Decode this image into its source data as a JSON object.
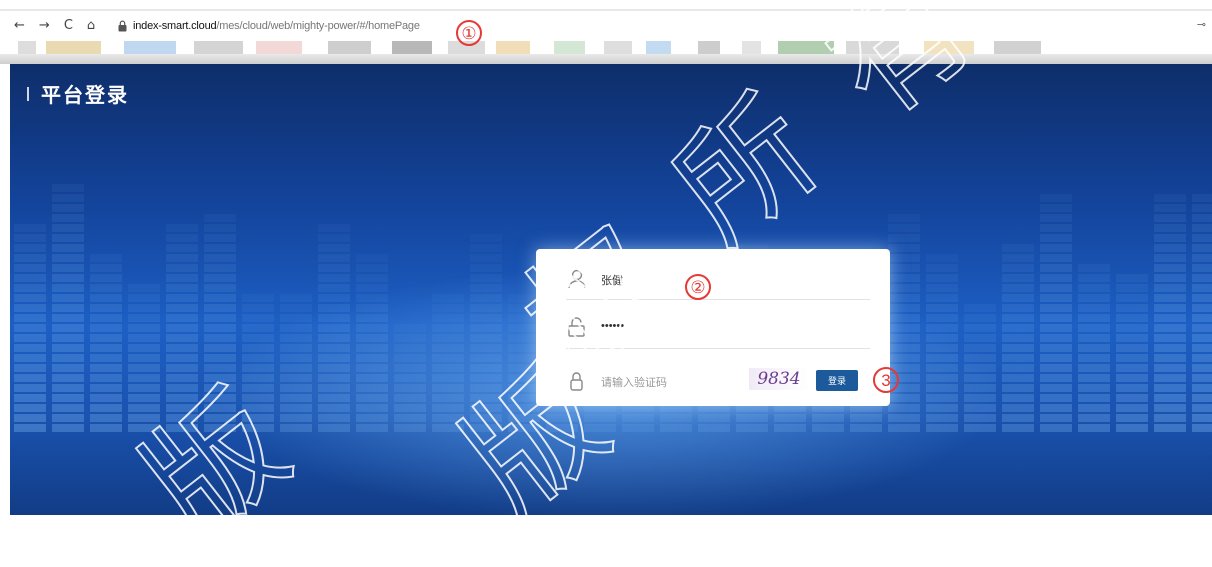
{
  "browser": {
    "nav": {
      "back": "←",
      "forward": "→",
      "reload": "C",
      "home": "⌂"
    },
    "url": {
      "host": "index-smart.cloud",
      "path": "/mes/cloud/web/mighty-power/#/homePage"
    },
    "bookmark_colors": [
      "#d9d9d9",
      "#e7d6a8",
      "#b9d3ee",
      "#cfcfcf",
      "#f2d4d4",
      "#c9c9c9",
      "#b0b0b0",
      "#d8d8d8",
      "#f0d9b0",
      "#cfe3cf",
      "#dadada",
      "#bcd7f0",
      "#c8c8c8",
      "#e0e0e0",
      "#a9c9a9",
      "#d5d5d5",
      "#f0e0b8",
      "#cccccc"
    ]
  },
  "callouts": [
    "①",
    "②",
    "3"
  ],
  "page": {
    "title": "平台登录"
  },
  "login": {
    "username": "张健",
    "password": "••••••",
    "captcha_placeholder": "请输入验证码",
    "captcha_code": "9834",
    "button": "登录"
  },
  "watermark": {
    "chars": [
      "版",
      "权",
      "所",
      "有",
      "版"
    ]
  },
  "colors": {
    "accent": "#1c5a9b",
    "callout": "#e53935",
    "bg_top": "#0e2e6a",
    "bg_mid": "#1d5fc4"
  }
}
